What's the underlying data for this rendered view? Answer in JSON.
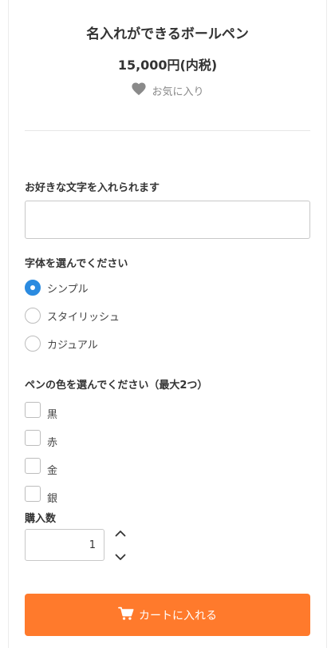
{
  "product": {
    "title": "名入れができるボールペン",
    "price": "15,000円(内税)",
    "favorite_label": "お気に入り"
  },
  "engraving": {
    "label": "お好きな文字を入れられます",
    "value": "",
    "placeholder": ""
  },
  "font_style": {
    "label": "字体を選んでください",
    "options": [
      {
        "label": "シンプル",
        "selected": true
      },
      {
        "label": "スタイリッシュ",
        "selected": false
      },
      {
        "label": "カジュアル",
        "selected": false
      }
    ]
  },
  "pen_color": {
    "label": "ペンの色を選んでください（最大2つ）",
    "options": [
      {
        "label": "黒",
        "checked": false
      },
      {
        "label": "赤",
        "checked": false
      },
      {
        "label": "金",
        "checked": false
      },
      {
        "label": "銀",
        "checked": false
      }
    ]
  },
  "quantity": {
    "label": "購入数",
    "value": "1"
  },
  "cart": {
    "button_label": "カートに入れる"
  },
  "colors": {
    "accent": "#ff7a2c",
    "radio_selected": "#2b8be0"
  },
  "icons": {
    "favorite": "heart-icon",
    "cart": "cart-icon",
    "increment": "chevron-up-icon",
    "decrement": "chevron-down-icon"
  }
}
